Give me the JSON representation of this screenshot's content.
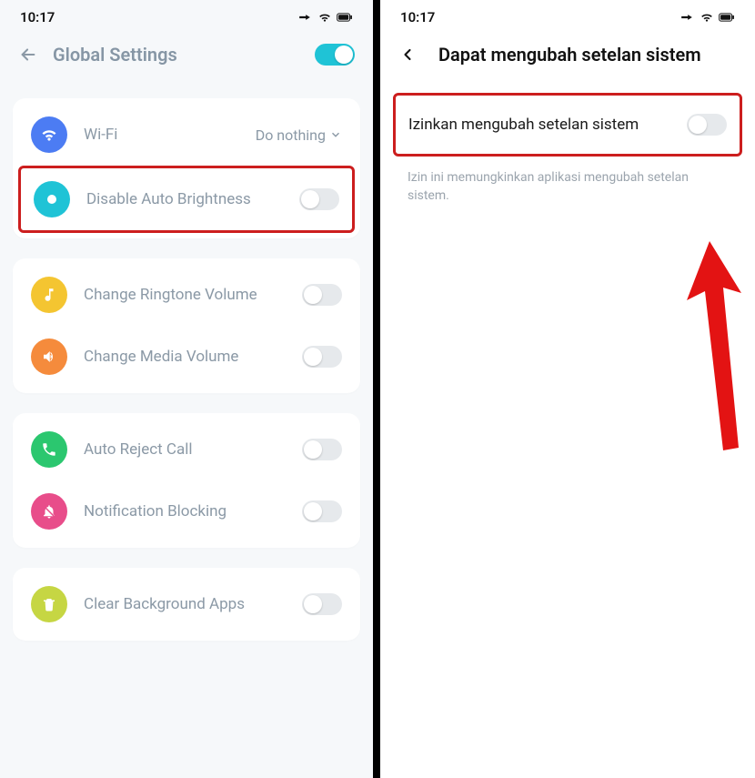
{
  "left": {
    "statusbar": {
      "time": "10:17"
    },
    "header": {
      "title": "Global Settings",
      "toggle_on": true
    },
    "card1": {
      "wifi": {
        "label": "Wi-Fi",
        "action": "Do nothing",
        "color": "#4c7cf3"
      },
      "auto_brightness": {
        "label": "Disable Auto Brightness",
        "color": "#1fc3d6"
      }
    },
    "card2": {
      "ringtone": {
        "label": "Change Ringtone Volume",
        "color": "#f4c531"
      },
      "media": {
        "label": "Change Media Volume",
        "color": "#f58b3c"
      }
    },
    "card3": {
      "autoreject": {
        "label": "Auto Reject Call",
        "color": "#2bc76f"
      },
      "notifblock": {
        "label": "Notification Blocking",
        "color": "#e84d8a"
      }
    },
    "card4": {
      "clearbg": {
        "label": "Clear Background Apps",
        "color": "#c6d643"
      }
    }
  },
  "right": {
    "statusbar": {
      "time": "10:17"
    },
    "header": {
      "title": "Dapat mengubah setelan sistem"
    },
    "permission": {
      "label": "Izinkan mengubah setelan sistem",
      "description": "Izin ini memungkinkan aplikasi mengubah setelan sistem."
    }
  }
}
